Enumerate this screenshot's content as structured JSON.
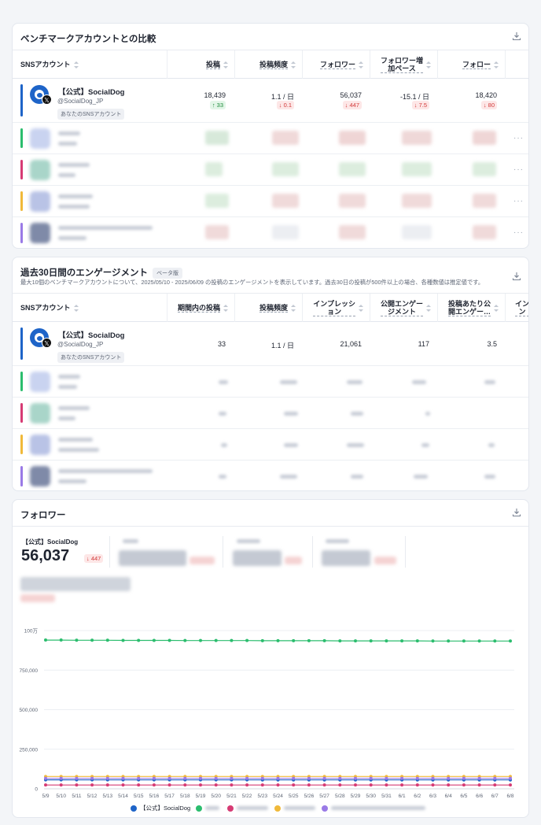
{
  "benchmark": {
    "title": "ベンチマークアカウントとの比較",
    "columns": [
      "SNSアカウント",
      "投稿",
      "投稿頻度",
      "フォロワー",
      "フォロワー増加ペース",
      "フォロー"
    ],
    "col_fw_line1": "フォロワー増",
    "col_fw_line2": "加ペース",
    "main": {
      "name": "【公式】SocialDog",
      "handle": "@SocialDog_JP",
      "tag": "あなたのSNSアカウント",
      "values": [
        "18,439",
        "1.1 / 日",
        "56,037",
        "-15.1 / 日",
        "18,420"
      ],
      "deltas": [
        {
          "text": "↑ 33",
          "dir": "up"
        },
        {
          "text": "↓ 0.1",
          "dir": "down"
        },
        {
          "text": "↓ 447",
          "dir": "down"
        },
        {
          "text": "↓ 7.5",
          "dir": "down"
        },
        {
          "text": "↓ 80",
          "dir": "down"
        }
      ]
    },
    "more_icon": "···"
  },
  "engagement": {
    "title": "過去30日間のエンゲージメント",
    "badge": "ベータ版",
    "description": "最大10個のベンチマークアカウントについて、2025/05/10 - 2025/06/09 の投稿のエンゲージメントを表示しています。過去30日の投稿が500件以上の場合、各種数値は推定値です。",
    "columns": [
      "SNSアカウント",
      "期間内の投稿",
      "投稿頻度",
      "インプレッション",
      "公開エンゲージメント",
      "投稿あたり公開エンゲー…",
      "イン"
    ],
    "col_imp_line1": "インプレッシ",
    "col_imp_line2": "ョン",
    "col_pub_line1": "公開エンゲー",
    "col_pub_line2": "ジメント",
    "col_per_line1": "投稿あたり公",
    "col_per_line2": "開エンゲー…",
    "col_last_line1": "イン",
    "col_last_line2": "ン",
    "main": {
      "name": "【公式】SocialDog",
      "handle": "@SocialDog_JP",
      "tag": "あなたのSNSアカウント",
      "values": [
        "33",
        "1.1 / 日",
        "21,061",
        "117",
        "3.5"
      ]
    }
  },
  "followers": {
    "title": "フォロワー",
    "kpi_label": "【公式】SocialDog",
    "kpi_value": "56,037",
    "kpi_delta": "↓ 447",
    "legend_main": "【公式】SocialDog"
  },
  "colors": {
    "accent_blue": "#1e64c8",
    "green": "#2bbd6e",
    "pink": "#d63b74",
    "yellow": "#f0b93a",
    "purple": "#9a7ae6"
  },
  "chart_data": {
    "type": "line",
    "x": [
      "5/9",
      "5/10",
      "5/11",
      "5/12",
      "5/13",
      "5/14",
      "5/15",
      "5/16",
      "5/17",
      "5/18",
      "5/19",
      "5/20",
      "5/21",
      "5/22",
      "5/23",
      "5/24",
      "5/25",
      "5/26",
      "5/27",
      "5/28",
      "5/29",
      "5/30",
      "5/31",
      "6/1",
      "6/2",
      "6/3",
      "6/4",
      "6/5",
      "6/6",
      "6/7",
      "6/8"
    ],
    "yticks": [
      "0",
      "250,000",
      "500,000",
      "750,000",
      "100万"
    ],
    "ylim": [
      0,
      1000000
    ],
    "grid": true,
    "series": [
      {
        "name": "【公式】SocialDog",
        "color": "#1e64c8",
        "values": [
          56484,
          56470,
          56455,
          56440,
          56425,
          56410,
          56395,
          56380,
          56365,
          56350,
          56335,
          56320,
          56305,
          56290,
          56275,
          56260,
          56245,
          56230,
          56215,
          56200,
          56185,
          56170,
          56155,
          56140,
          56125,
          56110,
          56095,
          56080,
          56065,
          56050,
          56037
        ]
      },
      {
        "color": "#2bbd6e",
        "values": [
          940000,
          940000,
          939000,
          939000,
          939000,
          938000,
          938000,
          938000,
          938000,
          937000,
          937000,
          937000,
          937000,
          937000,
          936000,
          936000,
          936000,
          936000,
          936000,
          935000,
          935000,
          935000,
          935000,
          935000,
          935000,
          934000,
          934000,
          934000,
          934000,
          934000,
          934000
        ]
      },
      {
        "color": "#d63b74",
        "values": [
          24000,
          24000,
          24000,
          24000,
          24000,
          24000,
          24000,
          24000,
          24000,
          24000,
          24000,
          24000,
          24000,
          24000,
          24000,
          24000,
          24000,
          24000,
          24000,
          24000,
          24000,
          24000,
          24000,
          24000,
          24000,
          24000,
          24000,
          24000,
          24000,
          24000,
          24000
        ]
      },
      {
        "color": "#f0b93a",
        "values": [
          78000,
          78000,
          78000,
          78000,
          78000,
          78000,
          78000,
          78000,
          78000,
          78000,
          78000,
          78000,
          78000,
          78000,
          78000,
          78000,
          78000,
          78000,
          78000,
          78000,
          78000,
          78000,
          78000,
          78000,
          78000,
          78000,
          78000,
          78000,
          78000,
          78000,
          78000
        ]
      },
      {
        "color": "#9a7ae6",
        "values": [
          66000,
          66000,
          66000,
          66000,
          66000,
          66000,
          66000,
          66000,
          66000,
          66000,
          66000,
          66000,
          66000,
          66000,
          66000,
          66000,
          66000,
          66000,
          66000,
          66000,
          66000,
          66000,
          66000,
          66000,
          66000,
          66000,
          66000,
          66000,
          66000,
          66000,
          66000
        ]
      }
    ]
  }
}
